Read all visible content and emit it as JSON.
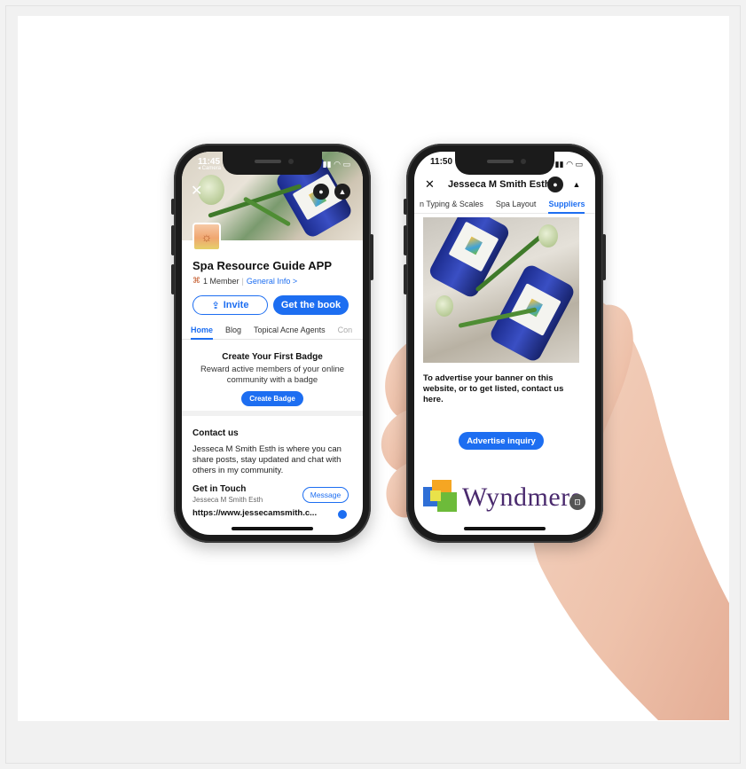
{
  "left_phone": {
    "status_time": "11:45",
    "status_back": "◂ Camera",
    "group_title": "Spa Resource Guide APP",
    "members": "1 Member",
    "general_info": "General Info >",
    "invite_label": "Invite",
    "get_book_label": "Get the book",
    "tabs": [
      "Home",
      "Blog",
      "Topical Acne Agents",
      "Con"
    ],
    "badge_title": "Create Your First Badge",
    "badge_desc": "Reward active members of your online community with a badge",
    "create_badge_label": "Create Badge",
    "contact_title": "Contact us",
    "contact_body": "Jesseca M Smith Esth is where you can share posts, stay updated and chat with others in my community.",
    "get_in_touch": "Get in Touch",
    "owner": "Jesseca M Smith Esth",
    "message_label": "Message",
    "url": "https://www.jessecamsmith.c..."
  },
  "right_phone": {
    "status_time": "11:50",
    "header_title": "Jesseca M Smith Esth",
    "tabs": [
      "n Typing & Scales",
      "Spa Layout",
      "Suppliers"
    ],
    "ad_text": "To advertise your banner on this website, or to get listed, contact us here.",
    "advertise_label": "Advertise inquiry",
    "brand_word": "Wyndmere"
  },
  "colors": {
    "accent": "#1d6ef1",
    "brand_purple": "#4a2a6e"
  }
}
